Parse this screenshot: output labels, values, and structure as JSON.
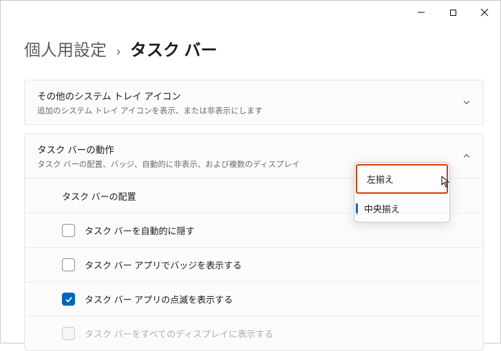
{
  "titlebar": {
    "minimize_name": "minimize-icon",
    "maximize_name": "maximize-icon",
    "close_name": "close-icon"
  },
  "breadcrumb": {
    "previous": "個人用設定",
    "current": "タスク バー"
  },
  "panels": {
    "tray": {
      "title": "その他のシステム トレイ アイコン",
      "subtitle": "追加のシステム トレイ アイコンを表示、または非表示にします"
    },
    "behavior": {
      "title": "タスク バーの動作",
      "subtitle": "タスク バーの配置、バッジ、自動的に非表示、および複数のディスプレイ"
    }
  },
  "rows": {
    "alignment_label": "タスク バーの配置",
    "autohide_label": "タスク バーを自動的に隠す",
    "badges_label": "タスク バー アプリでバッジを表示する",
    "flashing_label": "タスク バー アプリの点滅を表示する",
    "alldisplays_label": "タスク バーをすべてのディスプレイに表示する"
  },
  "checkbox_states": {
    "autohide": false,
    "badges": false,
    "flashing": true,
    "alldisplays": false,
    "alldisplays_disabled": true
  },
  "dropdown": {
    "option_left": "左揃え",
    "option_center": "中央揃え",
    "selected": "中央揃え"
  }
}
